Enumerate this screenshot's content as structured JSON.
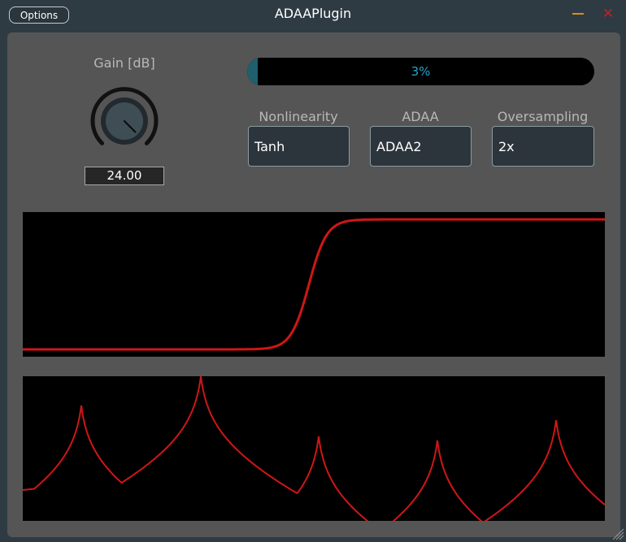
{
  "window": {
    "title": "ADAAPlugin",
    "options_label": "Options",
    "minimize_icon": "minimize-icon",
    "close_icon": "close-icon",
    "close_glyph": "✕"
  },
  "gain": {
    "label": "Gain [dB]",
    "value": "24.00",
    "knob_fraction": 1.0
  },
  "progress": {
    "text": "3%",
    "fraction": 0.03
  },
  "controls": {
    "nonlinearity": {
      "label": "Nonlinearity",
      "value": "Tanh"
    },
    "adaa": {
      "label": "ADAA",
      "value": "ADAA2"
    },
    "oversampling": {
      "label": "Oversampling",
      "value": "2x"
    }
  },
  "colors": {
    "accent": "#d01616",
    "progress_text": "#27a4c4",
    "panel": "#555555",
    "background": "#2f3b43"
  }
}
